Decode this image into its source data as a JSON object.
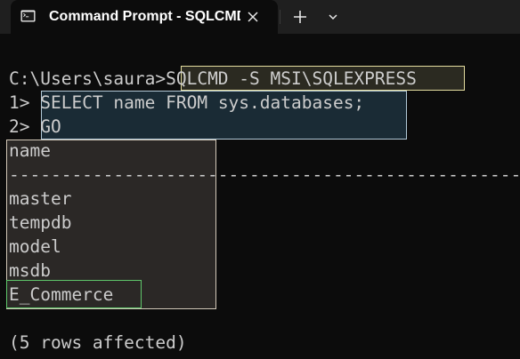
{
  "window": {
    "tab_title": "Command Prompt - SQLCMD",
    "tab_icon": "terminal-icon",
    "close_icon": "close-icon",
    "new_tab_icon": "plus-icon",
    "dropdown_icon": "chevron-down-icon"
  },
  "colors": {
    "terminal_background": "#0c0c0c",
    "terminal_text": "#cccccc",
    "command_highlight_border": "#e4dd9f",
    "query_highlight_border": "#b2c8d6",
    "results_highlight_border": "#d2c8b8",
    "selected_row_border": "#5fc76b"
  },
  "terminal": {
    "prompt_path": "C:\\Users\\saura>",
    "command": "SQLCMD -S MSI\\SQLEXPRESS",
    "query_line_1_prefix": "1> ",
    "query_line_1": "SELECT name FROM sys.databases;",
    "query_line_2_prefix": "2> ",
    "query_line_2": "GO",
    "result_header": "name",
    "result_separator": "--------------------------------------------------------------------",
    "results": [
      "master",
      "tempdb",
      "model",
      "msdb",
      "E_Commerce"
    ],
    "rows_affected": "(5 rows affected)"
  }
}
